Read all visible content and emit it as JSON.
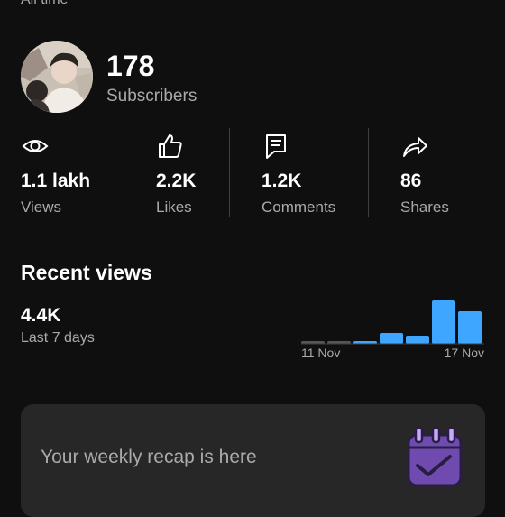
{
  "period": "All time",
  "channel": {
    "subscriber_count": "178",
    "subscriber_label": "Subscribers"
  },
  "stats": [
    {
      "icon": "eye-icon",
      "value": "1.1 lakh",
      "label": "Views"
    },
    {
      "icon": "thumbs-up-icon",
      "value": "2.2K",
      "label": "Likes"
    },
    {
      "icon": "comment-icon",
      "value": "1.2K",
      "label": "Comments"
    },
    {
      "icon": "share-icon",
      "value": "86",
      "label": "Shares"
    }
  ],
  "recent_views": {
    "title": "Recent views",
    "value": "4.4K",
    "period": "Last 7 days"
  },
  "chart_data": {
    "type": "bar",
    "values": [
      1,
      1,
      1,
      4,
      3,
      16,
      12
    ],
    "x_tick_labels": [
      "11 Nov",
      "17 Nov"
    ],
    "colors": {
      "inactive": "#555555",
      "active": "#3ea6ff"
    }
  },
  "recap": {
    "text": "Your weekly recap is here",
    "icon": "calendar-check-icon"
  }
}
